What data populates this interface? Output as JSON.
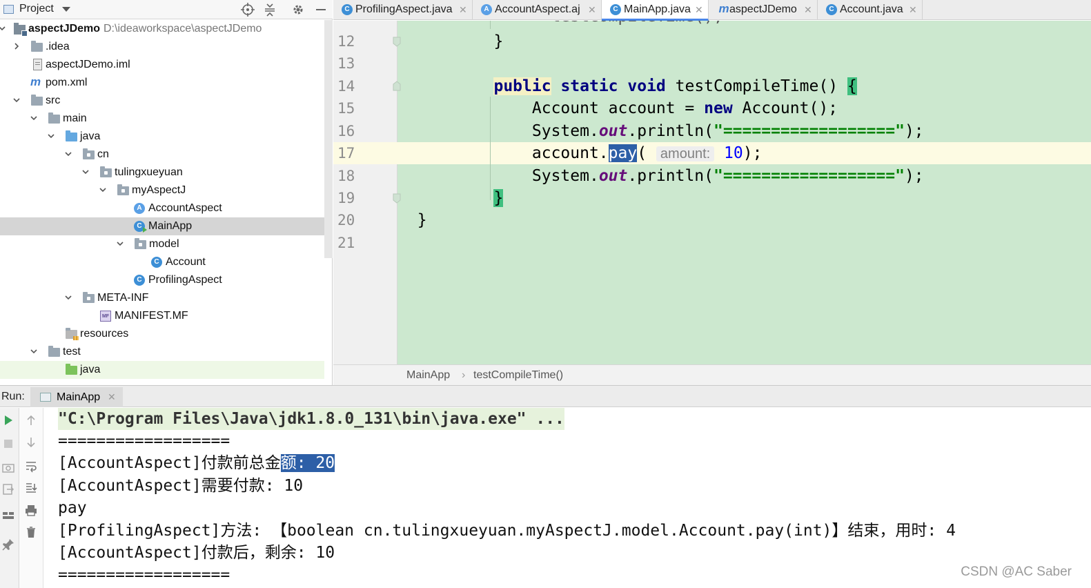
{
  "project_panel": {
    "title": "Project",
    "tree": [
      {
        "label": "aspectJDemo",
        "hint": "D:\\ideaworkspace\\aspectJDemo",
        "icon": "project-folder-icon"
      },
      {
        "label": ".idea",
        "icon": "folder-icon"
      },
      {
        "label": "aspectJDemo.iml",
        "icon": "iml-file-icon"
      },
      {
        "label": "pom.xml",
        "icon": "maven-icon"
      },
      {
        "label": "src",
        "icon": "folder-icon"
      },
      {
        "label": "main",
        "icon": "folder-icon"
      },
      {
        "label": "java",
        "icon": "source-folder-icon"
      },
      {
        "label": "cn",
        "icon": "package-icon"
      },
      {
        "label": "tulingxueyuan",
        "icon": "package-icon"
      },
      {
        "label": "myAspectJ",
        "icon": "package-icon"
      },
      {
        "label": "AccountAspect",
        "icon": "aspect-icon"
      },
      {
        "label": "MainApp",
        "icon": "runnable-class-icon"
      },
      {
        "label": "model",
        "icon": "package-icon"
      },
      {
        "label": "Account",
        "icon": "class-icon"
      },
      {
        "label": "ProfilingAspect",
        "icon": "class-icon"
      },
      {
        "label": "META-INF",
        "icon": "package-icon"
      },
      {
        "label": "MANIFEST.MF",
        "icon": "manifest-icon"
      },
      {
        "label": "resources",
        "icon": "resources-folder-icon"
      },
      {
        "label": "test",
        "icon": "folder-icon"
      },
      {
        "label": "java",
        "icon": "test-source-folder-icon"
      }
    ]
  },
  "tabs": [
    {
      "label": "ProfilingAspect.java",
      "icon": "class-icon",
      "icon_char": "C"
    },
    {
      "label": "AccountAspect.aj",
      "icon": "aspect-icon",
      "icon_char": "A"
    },
    {
      "label": "MainApp.java",
      "icon": "class-icon",
      "icon_char": "C",
      "active": true
    },
    {
      "label": "aspectJDemo",
      "icon": "maven-icon",
      "icon_char": "m"
    },
    {
      "label": "Account.java",
      "icon": "class-icon",
      "icon_char": "C"
    }
  ],
  "editor": {
    "line_numbers": [
      "12",
      "13",
      "14",
      "15",
      "16",
      "17",
      "18",
      "19",
      "20",
      "21"
    ],
    "code": {
      "l12_brace": "}",
      "l14_public": "public",
      "l14_static": "static",
      "l14_void": "void",
      "l14_name": "testCompileTime()",
      "l14_open": "{",
      "l15_a": "Account account =",
      "l15_new": "new",
      "l15_b": "Account();",
      "l16_a": "System.",
      "l16_out": "out",
      "l16_b": ".println(",
      "l16_str": "\"==================\"",
      "l16_c": ");",
      "l17_a": "account.",
      "l17_pay": "pay",
      "l17_paren": "(",
      "l17_hint": "amount:",
      "l17_num": "10",
      "l17_close": ");",
      "l18_a": "System.",
      "l18_out": "out",
      "l18_b": ".println(",
      "l18_str": "\"==================\"",
      "l18_c": ");",
      "l19_brace": "}",
      "l20_brace": "}"
    },
    "current_line": "17",
    "breadcrumb": [
      "MainApp",
      "testCompileTime()"
    ]
  },
  "run_panel": {
    "label": "Run:",
    "tab": "MainApp",
    "console": {
      "cmd": "\"C:\\Program Files\\Java\\jdk1.8.0_131\\bin\\java.exe\" ...",
      "sep1": "==================",
      "l3_a": "[AccountAspect]付款前总金",
      "l3_sel": "额: 20",
      "l4": "[AccountAspect]需要付款: 10",
      "l5": "pay",
      "l6": "[ProfilingAspect]方法: 【boolean cn.tulingxueyuan.myAspectJ.model.Account.pay(int)】结束，用时: 4",
      "l7": "[AccountAspect]付款后，剩余: 10",
      "sep2": "=================="
    }
  },
  "watermark": "CSDN @AC Saber",
  "colors": {
    "editor_bg": "#cce8cf",
    "current_line": "#fdfbe3",
    "keyword": "#000080",
    "string": "#008000",
    "selection": "#2d5fa7",
    "active_tab_underline": "#4a86e8"
  }
}
